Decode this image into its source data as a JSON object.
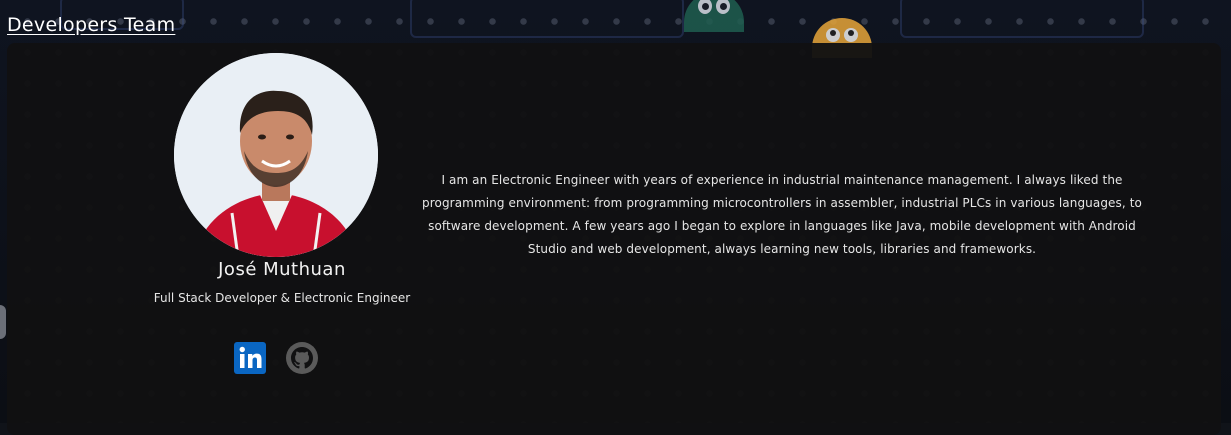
{
  "section": {
    "title": "Developers Team"
  },
  "member": {
    "name": "José Muthuan",
    "role": "Full Stack Developer & Electronic Engineer",
    "bio": "I am an Electronic Engineer with years of experience in industrial maintenance management. I always liked the programming environment: from programming microcontrollers in assembler, industrial PLCs in various languages, to software development. A few years ago I began to explore in languages like Java, mobile development with Android Studio and web development, always learning new tools, libraries and frameworks."
  },
  "socials": [
    {
      "icon": "linkedin-icon",
      "color": "#0a66c2"
    },
    {
      "icon": "github-icon",
      "color": "#5a5a5a"
    }
  ]
}
